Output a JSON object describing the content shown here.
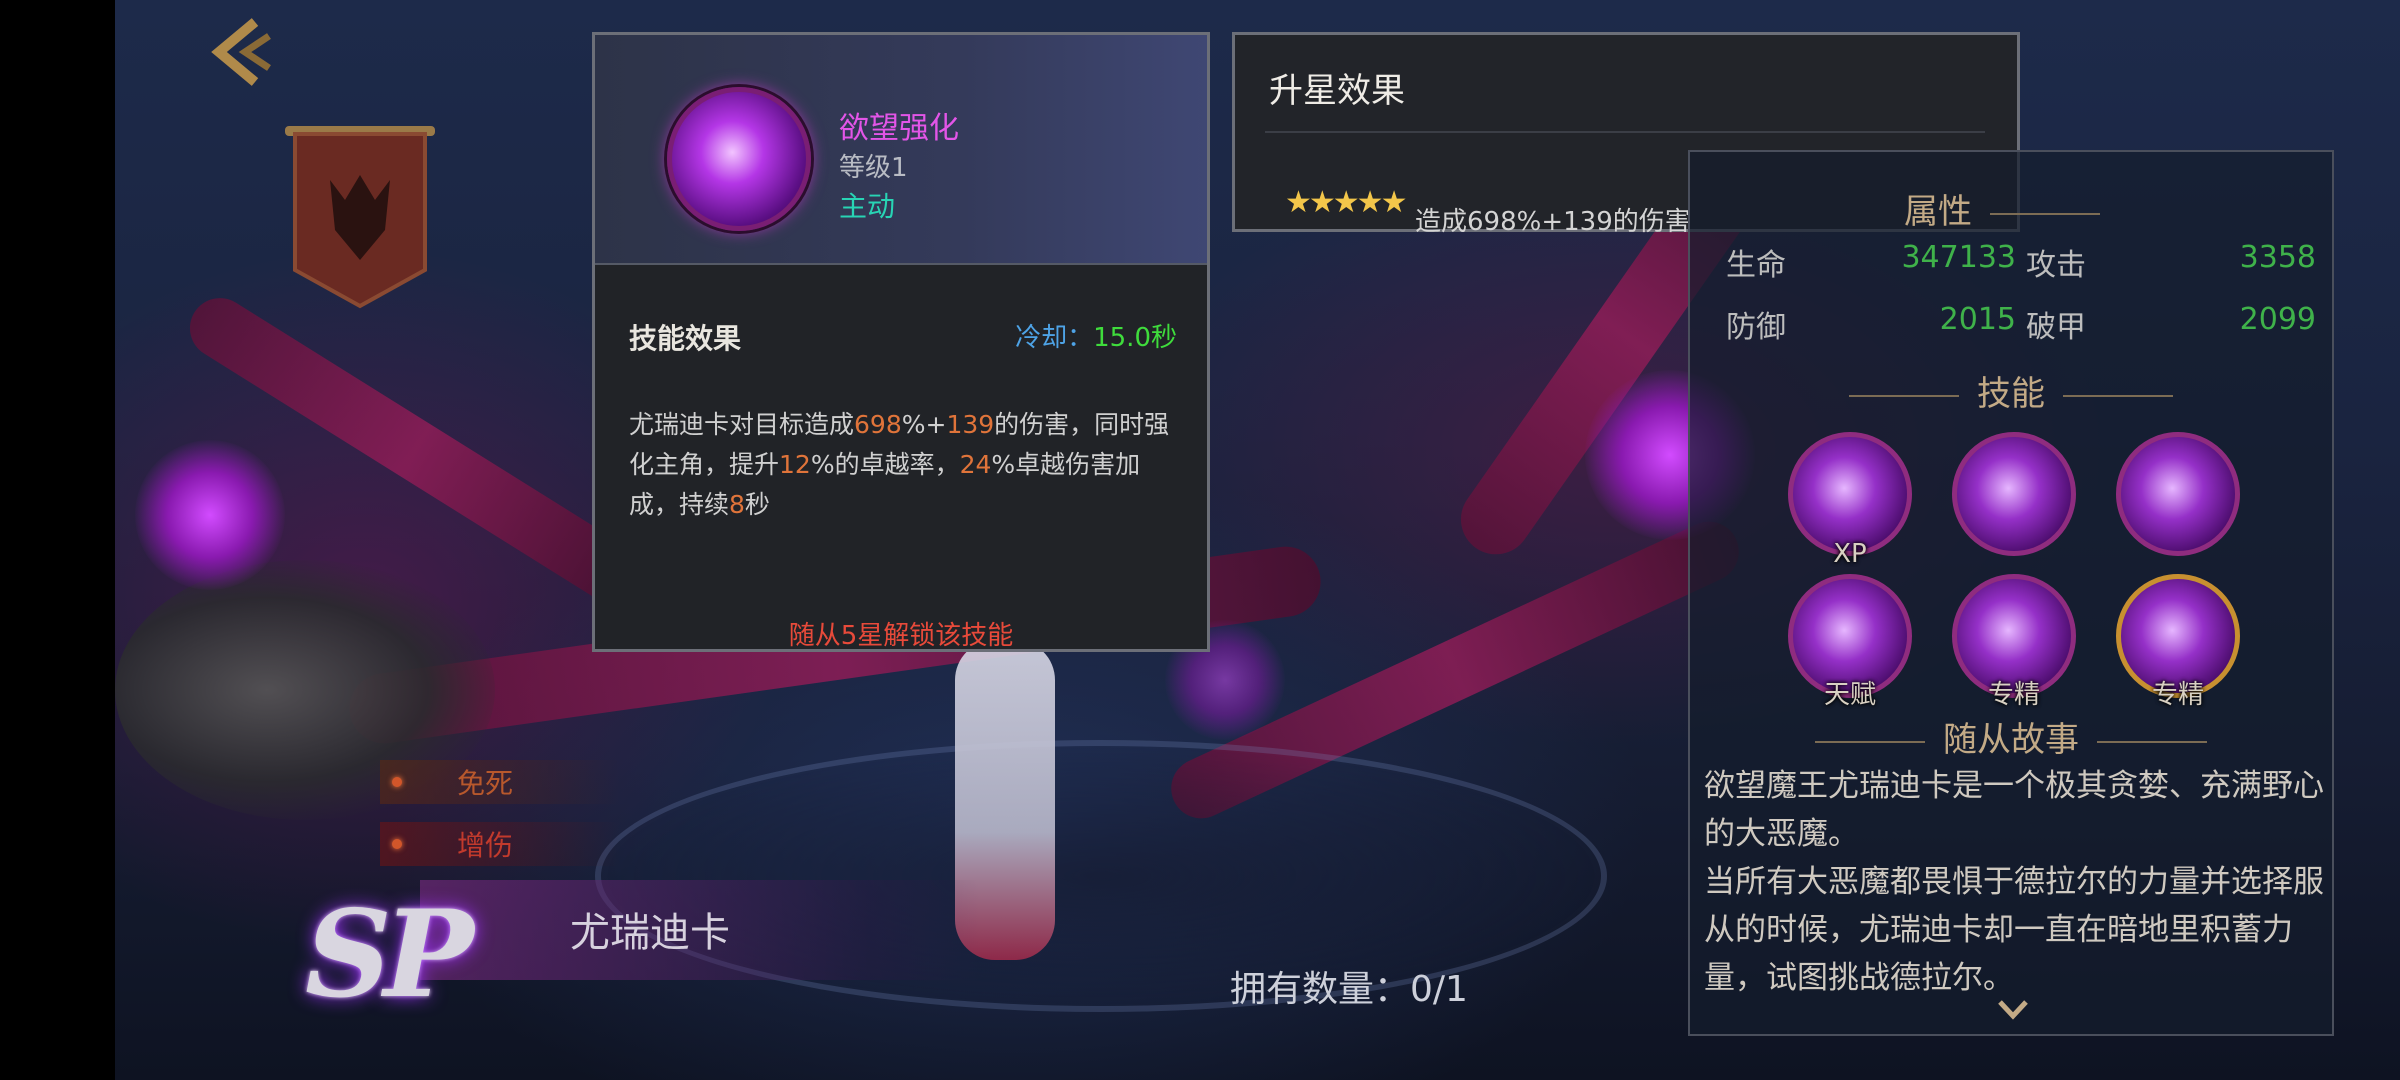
{
  "tags": [
    "免死",
    "增伤"
  ],
  "hero": {
    "rank": "SP",
    "name": "尤瑞迪卡",
    "owned_label": "拥有数量：0/1"
  },
  "skill_popup": {
    "name": "欲望强化",
    "level": "等级1",
    "type": "主动",
    "effect_title": "技能效果",
    "cooldown_label": "冷却：",
    "cooldown_value": "15.0秒",
    "desc": {
      "p1": "尤瑞迪卡对目标造成",
      "n1": "698",
      "p2": "%+",
      "n2": "139",
      "p3": "的伤害，同时强化主角，提升",
      "n3": "12",
      "p4": "%的卓越率，",
      "n4": "24",
      "p5": "%卓越伤害加成，持续",
      "n5": "8",
      "p6": "秒"
    },
    "unlock_text": "随从5星解锁该技能"
  },
  "star_popup": {
    "title": "升星效果",
    "stars": "★★★★★",
    "desc": "造成698%+139的伤害"
  },
  "info_panel": {
    "attr_title": "属性",
    "attrs": [
      {
        "label": "生命",
        "value": "347133"
      },
      {
        "label": "攻击",
        "value": "3358"
      },
      {
        "label": "防御",
        "value": "2015"
      },
      {
        "label": "破甲",
        "value": "2099"
      }
    ],
    "skills_title": "技能",
    "skill_captions": [
      "XP",
      "",
      "",
      "天赋",
      "专精",
      "专精"
    ],
    "story_title": "随从故事",
    "story_p1": "欲望魔王尤瑞迪卡是一个极其贪婪、充满野心的大恶魔。",
    "story_p2": "当所有大恶魔都畏惧于德拉尔的力量并选择服从的时候，尤瑞迪卡却一直在暗地里积蓄力量，试图挑战德拉尔。"
  },
  "colors": {
    "accent_pink": "#e355e8",
    "active_teal": "#28d4b4",
    "stat_green": "#3fb24a",
    "highlight_orange": "#e0743a",
    "unlock_red": "#e84a3a"
  }
}
